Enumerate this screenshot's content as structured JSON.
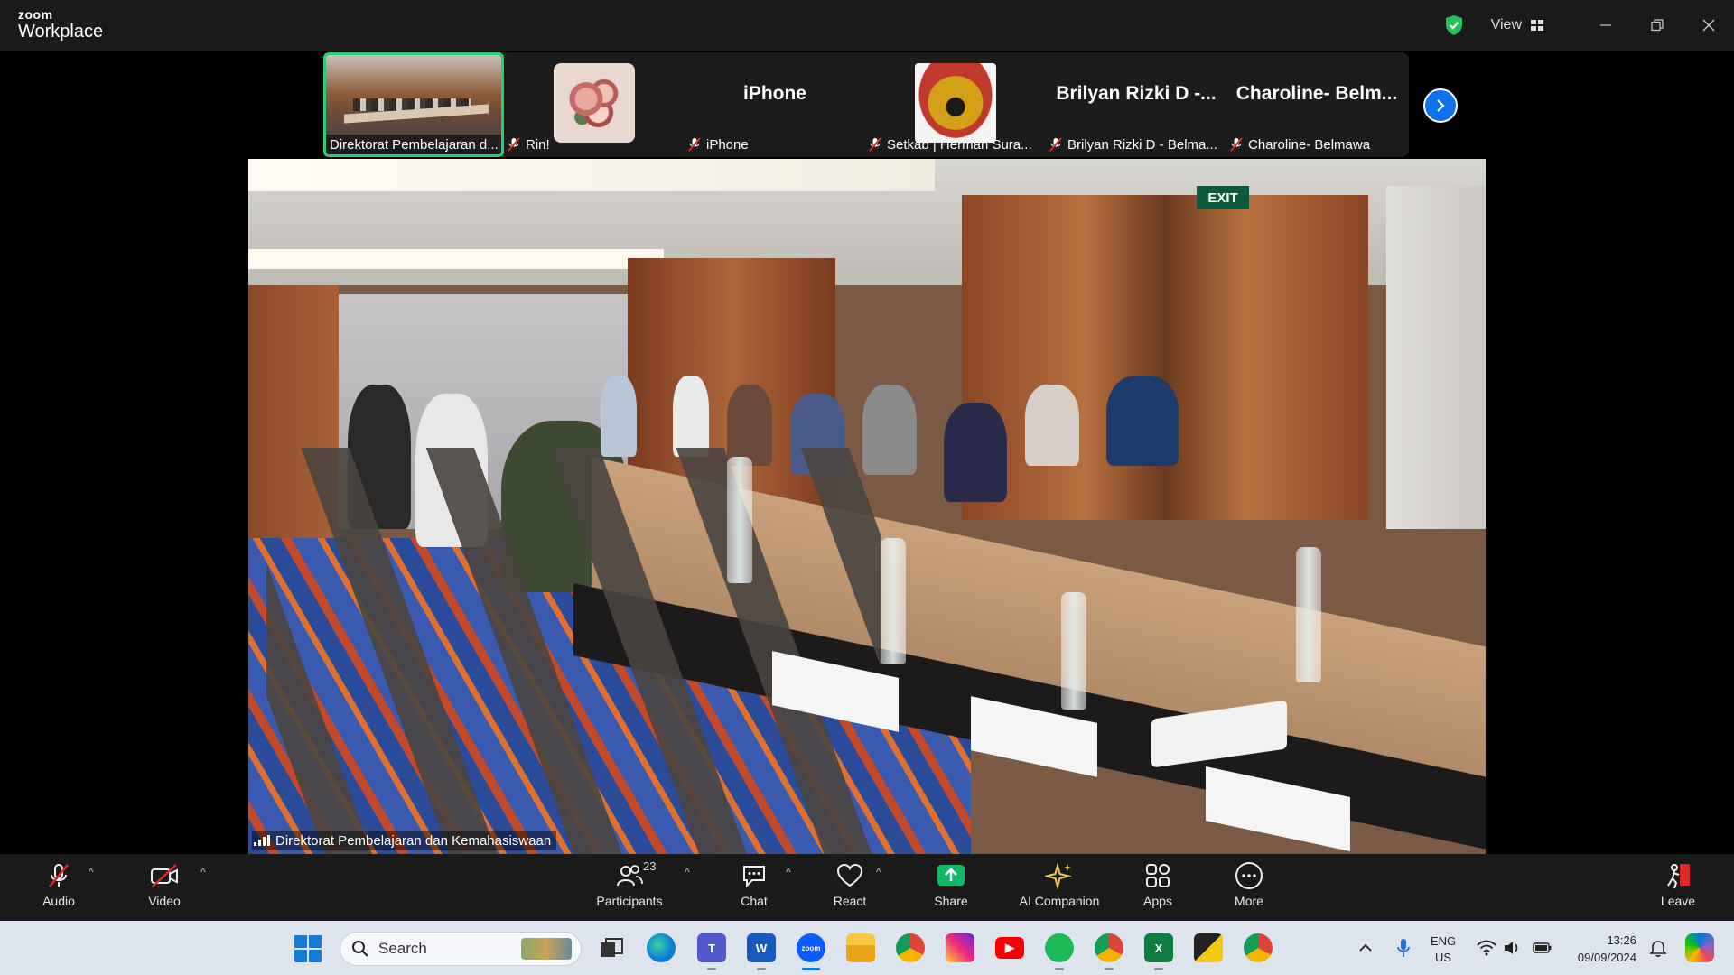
{
  "app": {
    "brand_small": "zoom",
    "brand_large": "Workplace",
    "view_label": "View"
  },
  "thumbnails": [
    {
      "label": "Direktorat Pembelajaran d...",
      "kind": "video",
      "muted": false,
      "active": true
    },
    {
      "label": "Rin!",
      "kind": "avatar-flower",
      "muted": true,
      "active": false
    },
    {
      "label": "iPhone",
      "display_name": "iPhone",
      "kind": "name",
      "muted": true,
      "active": false
    },
    {
      "label": "Setkab | Herman Sura...",
      "kind": "avatar-garuda",
      "muted": true,
      "active": false
    },
    {
      "label": "Brilyan Rizki D - Belma...",
      "display_name": "Brilyan Rizki D -...",
      "kind": "name",
      "muted": true,
      "active": false
    },
    {
      "label": "Charoline- Belmawa",
      "display_name": "Charoline- Belm...",
      "kind": "name",
      "muted": true,
      "active": false
    }
  ],
  "main_video": {
    "speaker_label": "Direktorat Pembelajaran dan Kemahasiswaan",
    "exit_sign": "EXIT"
  },
  "controls": {
    "audio": "Audio",
    "video": "Video",
    "participants": "Participants",
    "participants_count": "23",
    "chat": "Chat",
    "react": "React",
    "share": "Share",
    "ai_companion": "AI Companion",
    "apps": "Apps",
    "more": "More",
    "leave": "Leave"
  },
  "taskbar": {
    "search_placeholder": "Search",
    "zoom_icon_text": "zoom",
    "lang_top": "ENG",
    "lang_bottom": "US",
    "time": "13:26",
    "date": "09/09/2024"
  },
  "colors": {
    "accent_blue": "#0e72ed",
    "active_green": "#2ecc71",
    "share_green": "#12b76a",
    "mute_red": "#e02828"
  }
}
